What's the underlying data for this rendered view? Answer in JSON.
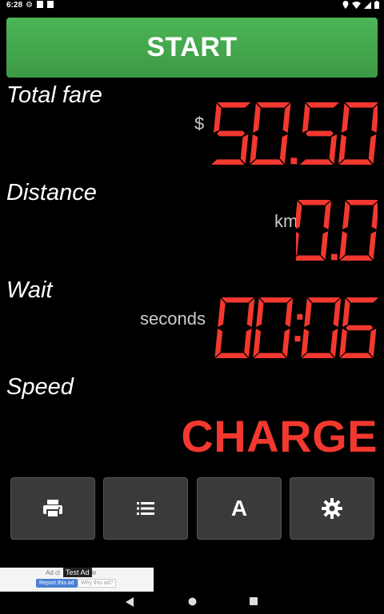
{
  "status_bar": {
    "time": "6:28"
  },
  "start_button": {
    "label": "START"
  },
  "fare": {
    "label": "Total fare",
    "unit": "$",
    "value": "50.50"
  },
  "distance": {
    "label": "Distance",
    "unit": "km",
    "value": "0.0"
  },
  "wait": {
    "label": "Wait",
    "unit": "seconds",
    "value": "00:06"
  },
  "speed": {
    "label": "Speed",
    "value": "CHARGE"
  },
  "toolbar": {
    "buttons": [
      {
        "icon": "printer-icon"
      },
      {
        "icon": "list-icon"
      },
      {
        "icon": "font-icon",
        "text": "A"
      },
      {
        "icon": "gear-icon"
      }
    ]
  },
  "ad": {
    "text": "Ad cl",
    "text2": "oogle",
    "badge": "Test Ad",
    "report": "Report this ad",
    "why": "Why this ad?"
  },
  "colors": {
    "led": "#f2382f",
    "start_green": "#43a84c",
    "button_bg": "#3a3a3a"
  }
}
